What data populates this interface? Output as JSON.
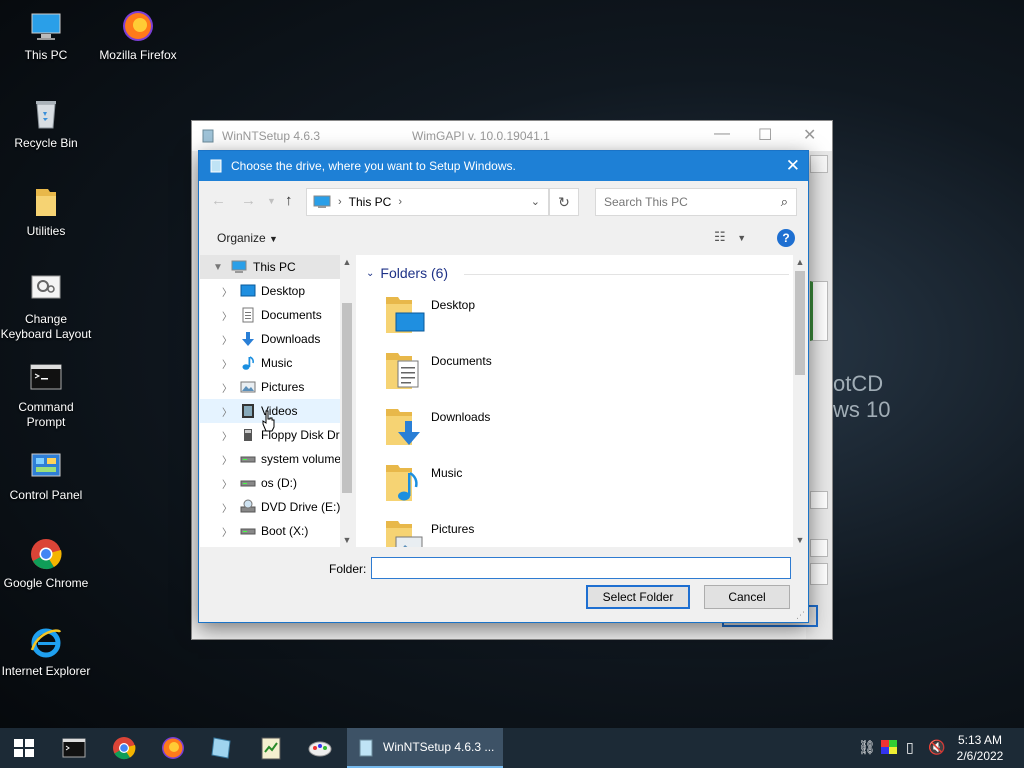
{
  "desktop": {
    "icons": [
      {
        "label": "This PC"
      },
      {
        "label": "Mozilla Firefox"
      },
      {
        "label": "Recycle Bin"
      },
      {
        "label": "Utilities"
      },
      {
        "label": "Change\nKeyboard Layout"
      },
      {
        "label": "Command\nPrompt"
      },
      {
        "label": "Control Panel"
      },
      {
        "label": "Google Chrome"
      },
      {
        "label": "Internet Explorer"
      }
    ],
    "bg_text_line1": "otCD",
    "bg_text_line2": "ws 10"
  },
  "back_window": {
    "title": "WinNTSetup 4.6.3",
    "subtitle": "WimGAPI v. 10.0.19041.1"
  },
  "dialog": {
    "title": "Choose the drive, where you want to Setup Windows.",
    "address": {
      "crumb": "This PC"
    },
    "search": {
      "placeholder": "Search This PC"
    },
    "toolbar": {
      "organize": "Organize"
    },
    "tree": [
      {
        "label": "This PC"
      },
      {
        "label": "Desktop"
      },
      {
        "label": "Documents"
      },
      {
        "label": "Downloads"
      },
      {
        "label": "Music"
      },
      {
        "label": "Pictures"
      },
      {
        "label": "Videos"
      },
      {
        "label": "Floppy Disk Dri"
      },
      {
        "label": "system volume"
      },
      {
        "label": "os (D:)"
      },
      {
        "label": "DVD Drive (E:) I"
      },
      {
        "label": "Boot (X:)"
      }
    ],
    "group_header": "Folders (6)",
    "folders": [
      {
        "name": "Desktop"
      },
      {
        "name": "Documents"
      },
      {
        "name": "Downloads"
      },
      {
        "name": "Music"
      },
      {
        "name": "Pictures"
      }
    ],
    "folder_field": {
      "label": "Folder:",
      "value": ""
    },
    "buttons": {
      "select": "Select Folder",
      "cancel": "Cancel"
    }
  },
  "taskbar": {
    "active_task": "WinNTSetup 4.6.3   ...",
    "clock": {
      "time": "5:13 AM",
      "date": "2/6/2022"
    }
  }
}
